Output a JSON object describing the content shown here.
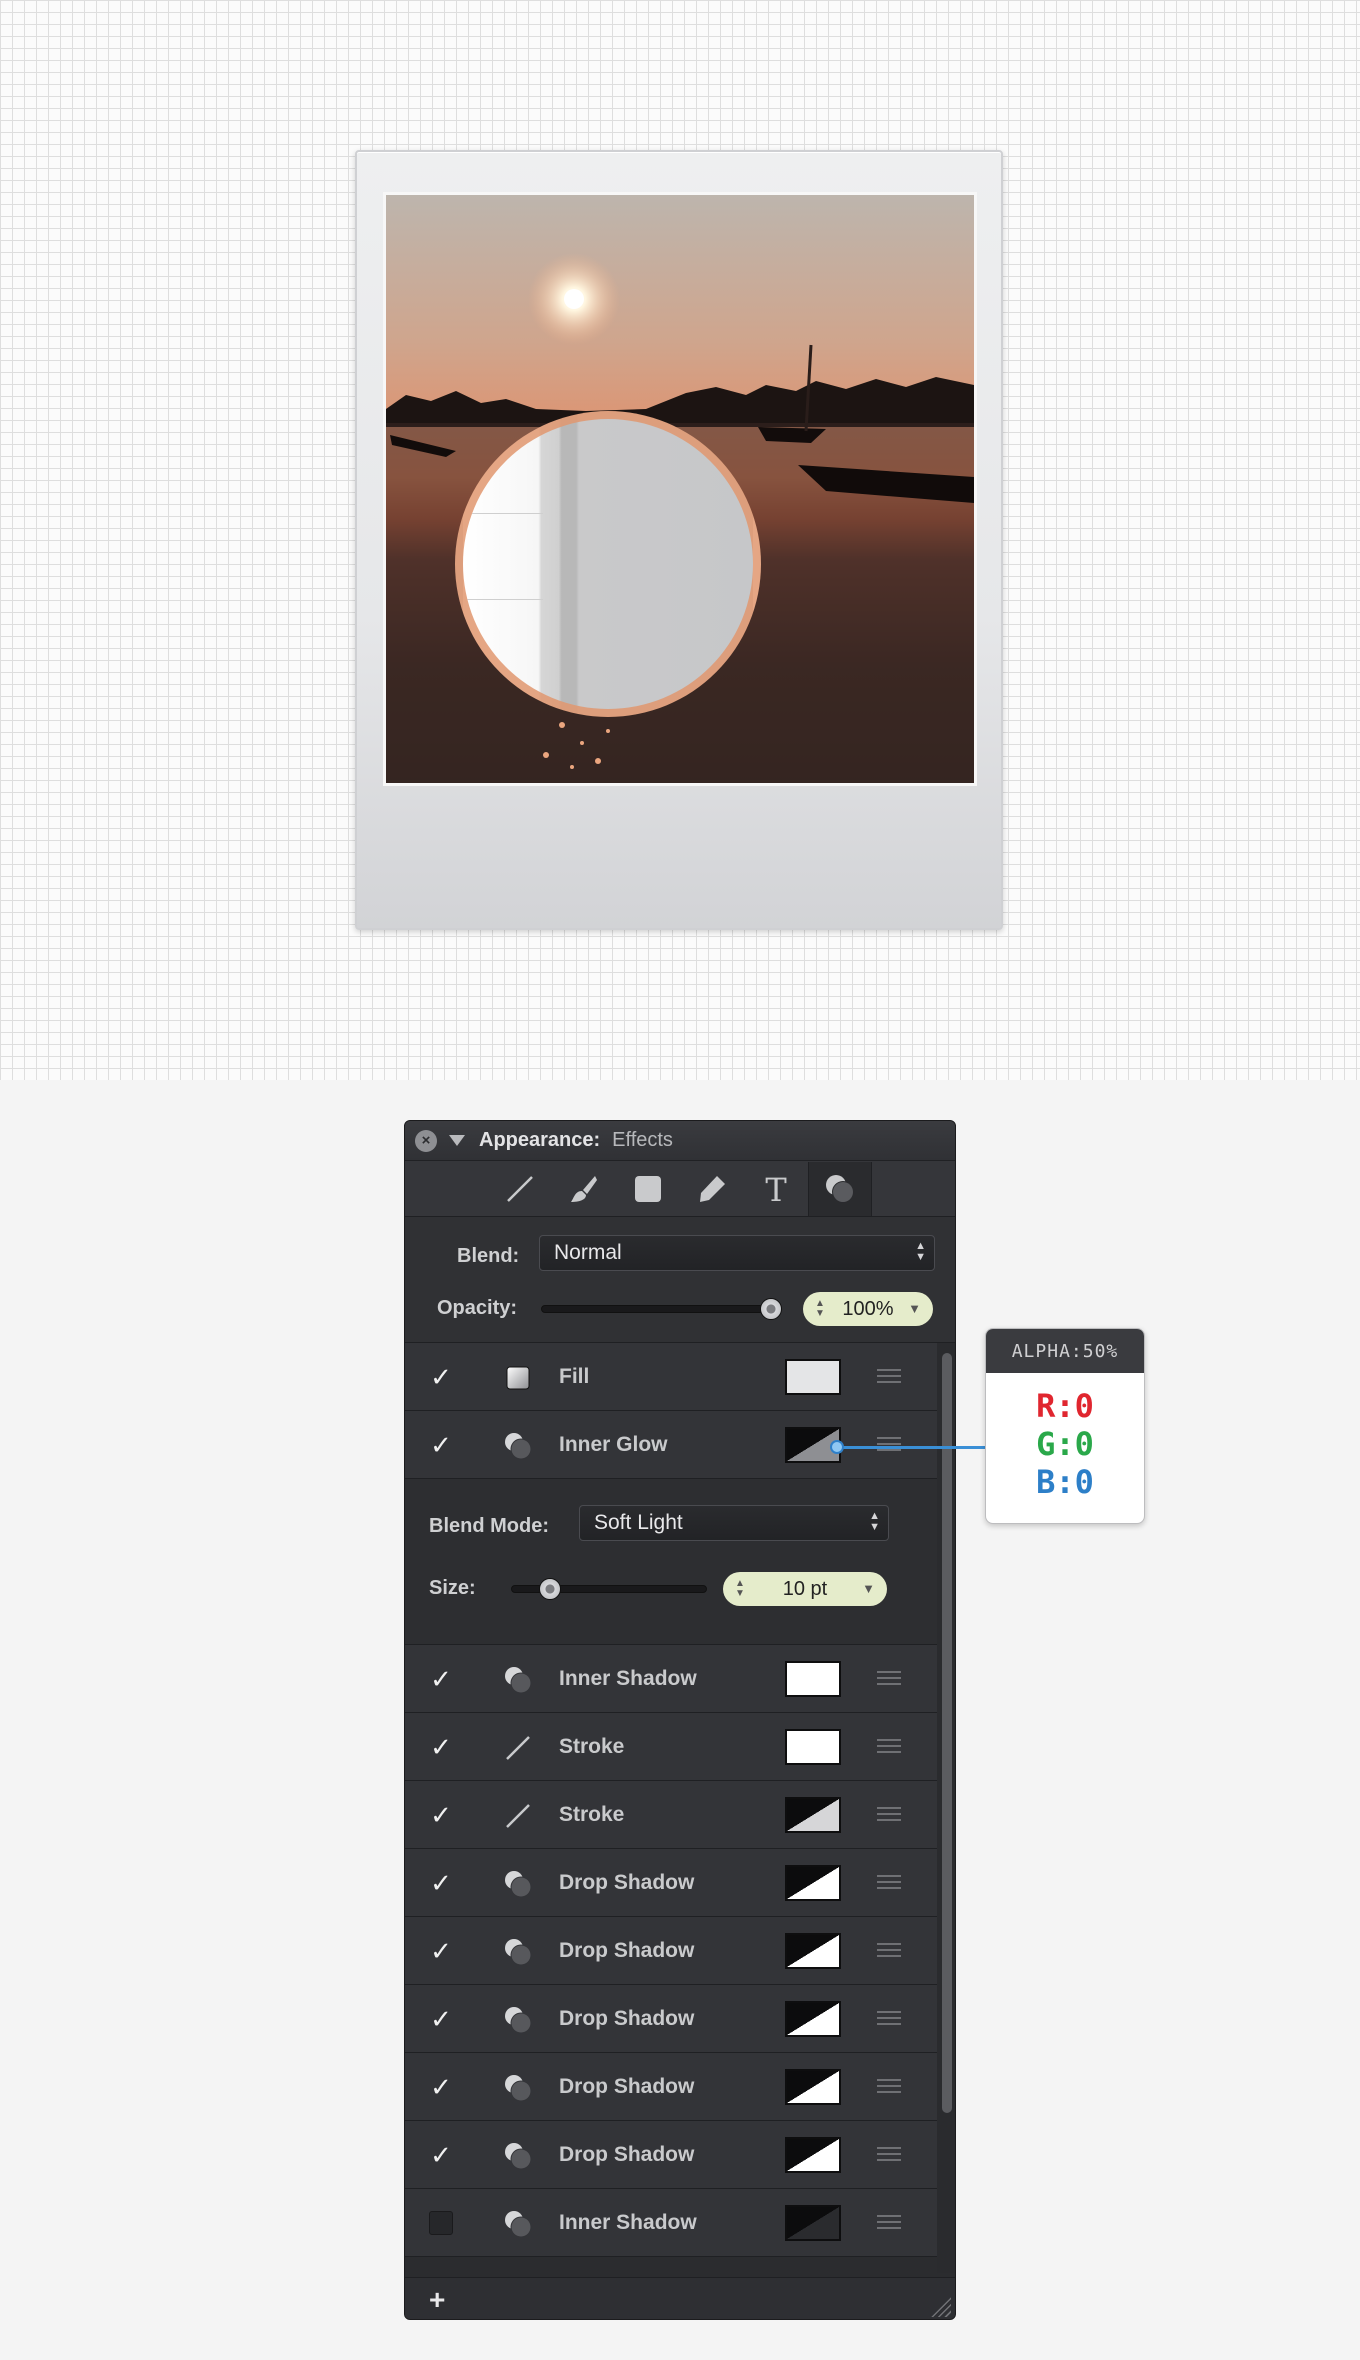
{
  "panel": {
    "title": "Appearance:",
    "subtitle": "Effects",
    "tabs": [
      "stroke-tab",
      "brush-tab",
      "fill-tab",
      "pencil-tab",
      "text-tab",
      "effects-tab"
    ],
    "blend": {
      "label": "Blend:",
      "value": "Normal"
    },
    "opacity": {
      "label": "Opacity:",
      "value": "100%",
      "level": 1.0
    },
    "expanded": {
      "blend_mode_label": "Blend Mode:",
      "blend_mode_value": "Soft Light",
      "size_label": "Size:",
      "size_value": "10 pt",
      "size_level": 0.2
    },
    "add_label": "+",
    "effects": [
      {
        "name": "Fill",
        "icon": "fill-icon",
        "checked": true,
        "swatch": "light"
      },
      {
        "name": "Inner Glow",
        "icon": "effect-icon",
        "checked": true,
        "swatch": "black-gray"
      },
      {
        "name": "Inner Shadow",
        "icon": "effect-icon",
        "checked": true,
        "swatch": "white"
      },
      {
        "name": "Stroke",
        "icon": "line-icon",
        "checked": true,
        "swatch": "white"
      },
      {
        "name": "Stroke",
        "icon": "line-icon",
        "checked": true,
        "swatch": "black-lightgray"
      },
      {
        "name": "Drop Shadow",
        "icon": "effect-icon",
        "checked": true,
        "swatch": "black-white"
      },
      {
        "name": "Drop Shadow",
        "icon": "effect-icon",
        "checked": true,
        "swatch": "black-white"
      },
      {
        "name": "Drop Shadow",
        "icon": "effect-icon",
        "checked": true,
        "swatch": "black-white"
      },
      {
        "name": "Drop Shadow",
        "icon": "effect-icon",
        "checked": true,
        "swatch": "black-white"
      },
      {
        "name": "Drop Shadow",
        "icon": "effect-icon",
        "checked": true,
        "swatch": "black-white"
      },
      {
        "name": "Inner Shadow",
        "icon": "effect-icon",
        "checked": false,
        "swatch": "black-darkgray"
      }
    ]
  },
  "callout": {
    "alpha": "ALPHA:50%",
    "r": "R:0",
    "g": "G:0",
    "b": "B:0",
    "colors": {
      "r": "#e0262f",
      "g": "#2aa84a",
      "b": "#2d7fc8"
    }
  }
}
